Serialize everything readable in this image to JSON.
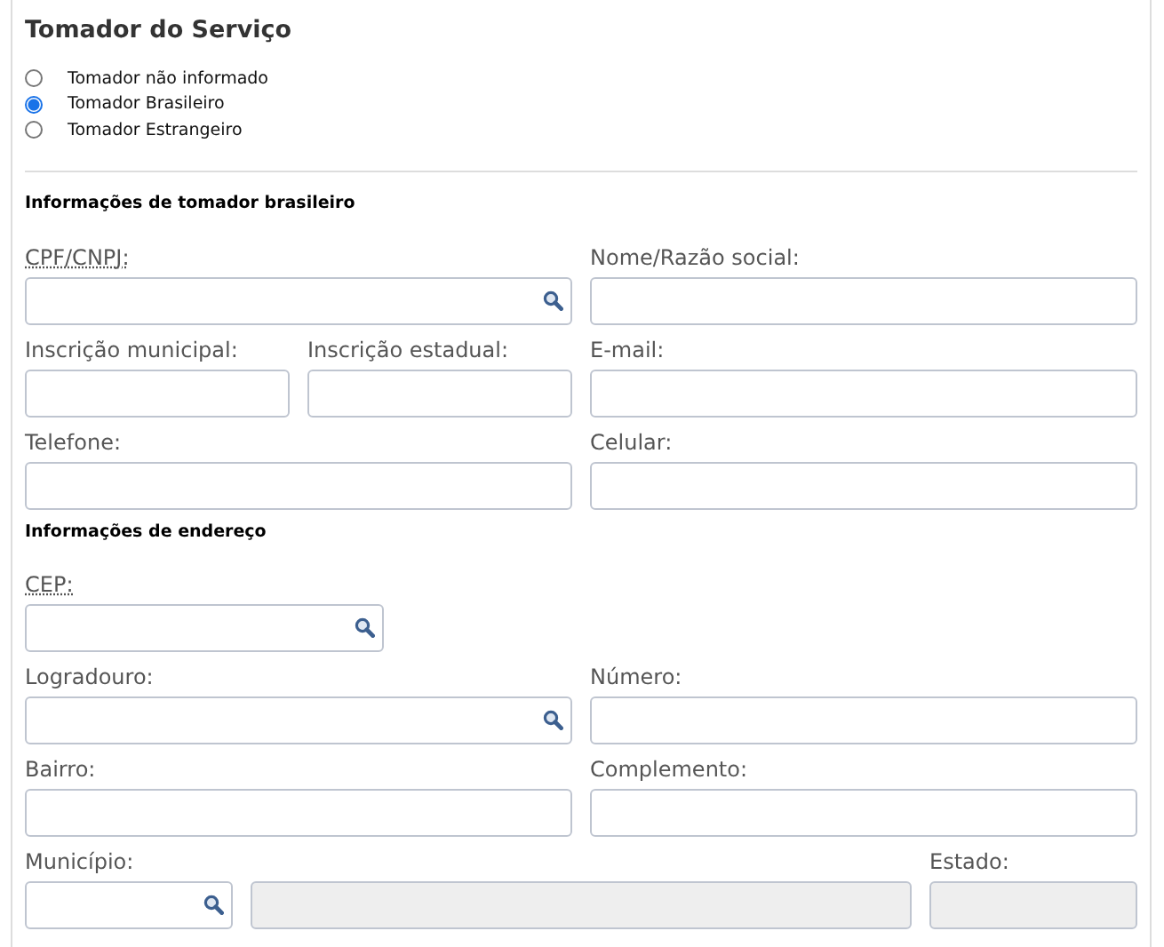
{
  "title": "Tomador do Serviço",
  "radios": [
    {
      "label": "Tomador não informado",
      "selected": false
    },
    {
      "label": "Tomador Brasileiro",
      "selected": true
    },
    {
      "label": "Tomador Estrangeiro",
      "selected": false
    }
  ],
  "sections": [
    {
      "heading": "Informações de tomador brasileiro",
      "rows": [
        [
          {
            "label": "CPF/CNPJ:",
            "abbr": true,
            "search": true
          },
          {
            "label": "Nome/Razão social:"
          }
        ],
        [
          {
            "label": "Inscrição municipal:"
          },
          {
            "label": "Inscrição estadual:"
          },
          {
            "label": "E-mail:"
          }
        ],
        [
          {
            "label": "Telefone:"
          },
          {
            "label": "Celular:"
          }
        ]
      ]
    },
    {
      "heading": "Informações de endereço",
      "rows": [
        [
          {
            "label": "CEP:",
            "abbr": true,
            "search": true
          }
        ],
        [
          {
            "label": "Logradouro:",
            "search": true
          },
          {
            "label": "Número:"
          }
        ],
        [
          {
            "label": "Bairro:"
          },
          {
            "label": "Complemento:"
          }
        ],
        [
          {
            "label": "Município:",
            "search": true
          },
          {
            "disabled": true
          },
          {
            "label": "Estado:",
            "disabled": true
          }
        ]
      ]
    }
  ]
}
